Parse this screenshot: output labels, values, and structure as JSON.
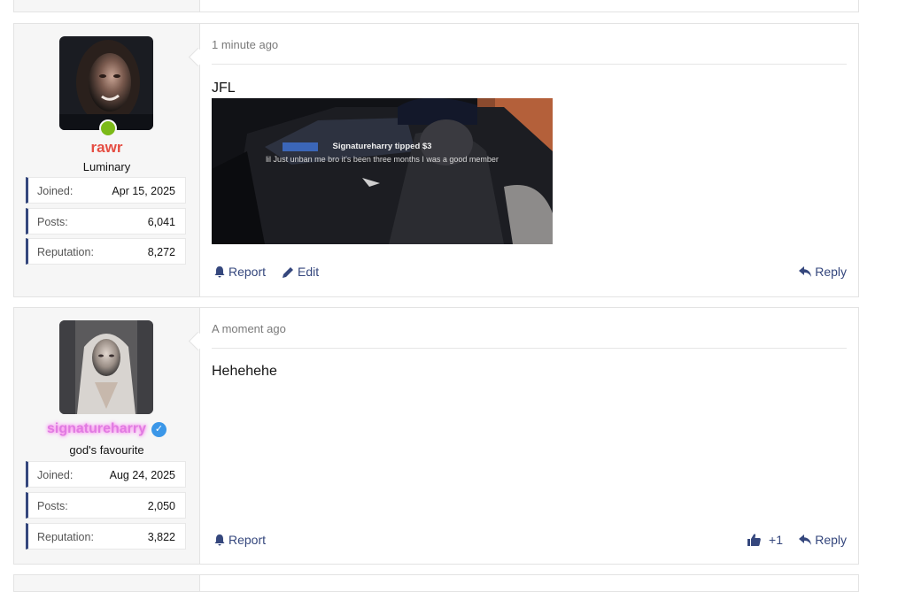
{
  "posts": [
    {
      "time": "1 minute ago",
      "user": {
        "name": "rawr",
        "title": "Luminary",
        "name_color": "#e54d42",
        "online": true,
        "stats": [
          {
            "label": "Joined:",
            "value": "Apr 15, 2025"
          },
          {
            "label": "Posts:",
            "value": "6,041"
          },
          {
            "label": "Reputation:",
            "value": "8,272"
          }
        ]
      },
      "message": "JFL",
      "media": {
        "tip_line": "Signatureharry tipped $3",
        "tip_message": "lil Just unban me bro it's been three months I was a good member"
      },
      "actions": {
        "report": "Report",
        "edit": "Edit",
        "reply": "Reply"
      }
    },
    {
      "time": "A moment ago",
      "user": {
        "name": "signatureharry",
        "title": "god's favourite",
        "name_color": "#e07be2",
        "verified": true,
        "stats": [
          {
            "label": "Joined:",
            "value": "Aug 24, 2025"
          },
          {
            "label": "Posts:",
            "value": "2,050"
          },
          {
            "label": "Reputation:",
            "value": "3,822"
          }
        ]
      },
      "message": "Hehehehe",
      "actions": {
        "report": "Report",
        "likes": "+1",
        "reply": "Reply"
      }
    }
  ],
  "colors": {
    "link": "#35477d",
    "sidebar_bg": "#f6f6f6",
    "online": "#7cba18",
    "verified": "#3b97e8"
  }
}
